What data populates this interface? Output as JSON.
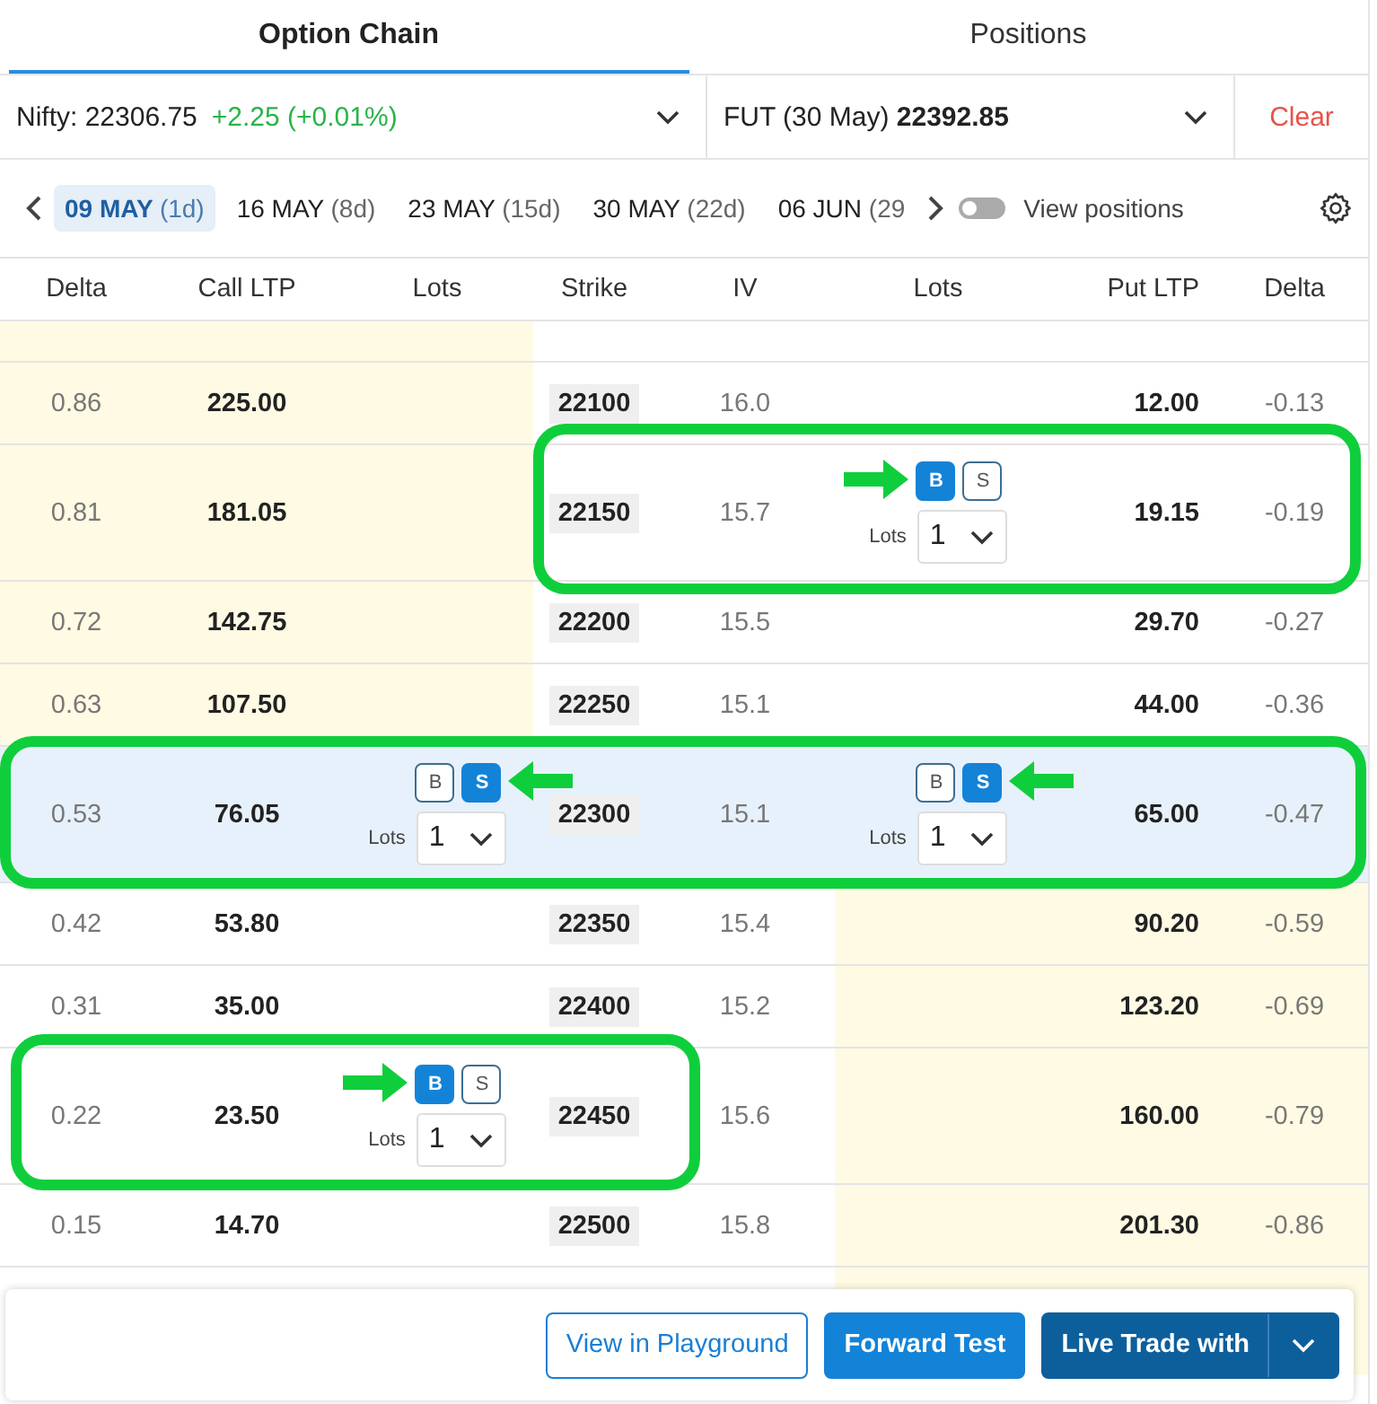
{
  "tabs": [
    {
      "label": "Option Chain",
      "selected": true
    },
    {
      "label": "Positions",
      "selected": false
    }
  ],
  "underlying": {
    "label": "Nifty: 22306.75",
    "change": "+2.25 (+0.01%)"
  },
  "future": {
    "text": "FUT (30 May) **22392.85**"
  },
  "clear": "Clear",
  "expiries": [
    {
      "date": "09 MAY",
      "days": "(1d)",
      "selected": true
    },
    {
      "date": "16 MAY",
      "days": "(8d)",
      "selected": false
    },
    {
      "date": "23 MAY",
      "days": "(15d)",
      "selected": false
    },
    {
      "date": "30 MAY",
      "days": "(22d)",
      "selected": false
    },
    {
      "date": "06 JUN",
      "days": "(29",
      "selected": false
    }
  ],
  "view_positions": {
    "label": "View positions",
    "on": false
  },
  "columns": [
    "Delta",
    "Call LTP",
    "Lots",
    "Strike",
    "IV",
    "Lots",
    "Put LTP",
    "Delta"
  ],
  "rows": [
    {
      "call_delta": "0.86",
      "call_ltp": "225.00",
      "strike": "22100",
      "iv": "16.0",
      "put_ltp": "12.00",
      "put_delta": "-0.13",
      "call_itm": true,
      "put_itm": false,
      "selected": false
    },
    {
      "call_delta": "0.81",
      "call_ltp": "181.05",
      "strike": "22150",
      "iv": "15.7",
      "put_ltp": "19.15",
      "put_delta": "-0.19",
      "call_itm": true,
      "put_itm": false,
      "selected": false,
      "callout": {
        "kind": "put"
      },
      "put_order": {
        "buttons": [
          {
            "label": "B",
            "selected": true
          },
          {
            "label": "S",
            "selected": false
          }
        ],
        "lots_label": "Lots",
        "lots": "1",
        "arrow": true
      }
    },
    {
      "call_delta": "0.72",
      "call_ltp": "142.75",
      "strike": "22200",
      "iv": "15.5",
      "put_ltp": "29.70",
      "put_delta": "-0.27",
      "call_itm": true,
      "put_itm": false,
      "selected": false
    },
    {
      "call_delta": "0.63",
      "call_ltp": "107.50",
      "strike": "22250",
      "iv": "15.1",
      "put_ltp": "44.00",
      "put_delta": "-0.36",
      "call_itm": true,
      "put_itm": false,
      "selected": false
    },
    {
      "call_delta": "0.53",
      "call_ltp": "76.05",
      "strike": "22300",
      "iv": "15.1",
      "put_ltp": "65.00",
      "put_delta": "-0.47",
      "call_itm": false,
      "put_itm": false,
      "selected": true,
      "callout": {
        "kind": "both"
      },
      "call_order": {
        "buttons": [
          {
            "label": "B",
            "selected": false
          },
          {
            "label": "S",
            "selected": true
          }
        ],
        "lots_label": "Lots",
        "lots": "1",
        "arrow": true
      },
      "put_order": {
        "buttons": [
          {
            "label": "B",
            "selected": false
          },
          {
            "label": "S",
            "selected": true
          }
        ],
        "lots_label": "Lots",
        "lots": "1",
        "arrow": true
      }
    },
    {
      "call_delta": "0.42",
      "call_ltp": "53.80",
      "strike": "22350",
      "iv": "15.4",
      "put_ltp": "90.20",
      "put_delta": "-0.59",
      "call_itm": false,
      "put_itm": true,
      "selected": false
    },
    {
      "call_delta": "0.31",
      "call_ltp": "35.00",
      "strike": "22400",
      "iv": "15.2",
      "put_ltp": "123.20",
      "put_delta": "-0.69",
      "call_itm": false,
      "put_itm": true,
      "selected": false
    },
    {
      "call_delta": "0.22",
      "call_ltp": "23.50",
      "strike": "22450",
      "iv": "15.6",
      "put_ltp": "160.00",
      "put_delta": "-0.79",
      "call_itm": false,
      "put_itm": true,
      "selected": false,
      "callout": {
        "kind": "call"
      },
      "call_order": {
        "buttons": [
          {
            "label": "B",
            "selected": true
          },
          {
            "label": "S",
            "selected": false
          }
        ],
        "lots_label": "Lots",
        "lots": "1",
        "arrow": true
      }
    },
    {
      "call_delta": "0.15",
      "call_ltp": "14.70",
      "strike": "22500",
      "iv": "15.8",
      "put_ltp": "201.30",
      "put_delta": "-0.86",
      "call_itm": false,
      "put_itm": true,
      "selected": false
    }
  ],
  "footer_buttons": [
    {
      "label": "View in Playground",
      "kind": "outline"
    },
    {
      "label": "Forward Test",
      "kind": "primary"
    },
    {
      "label": "Live Trade with",
      "kind": "split"
    }
  ]
}
